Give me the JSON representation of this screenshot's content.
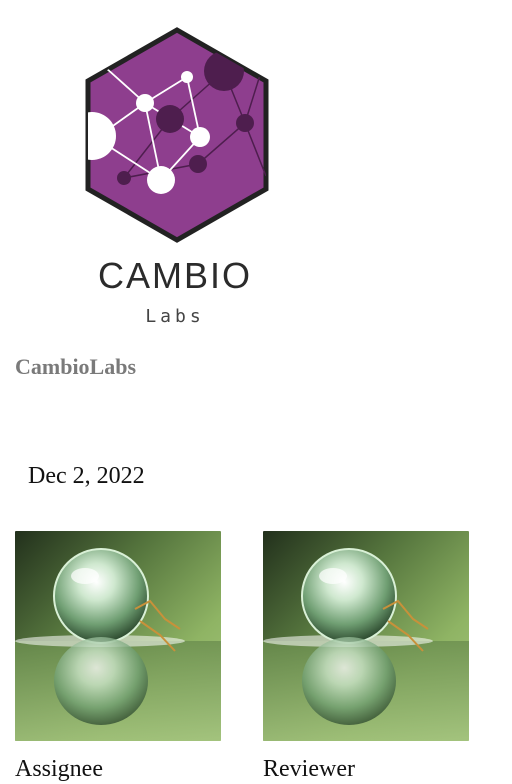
{
  "brand": {
    "logo_word": "CAMBIO",
    "logo_sub": "Labs",
    "name": "CambioLabs",
    "colors": {
      "hexagon": "#8e3e8e",
      "hexagon_border": "#222222",
      "node_dark": "#4e1e4e",
      "node_light": "#ffffff"
    }
  },
  "date": "Dec 2, 2022",
  "people": [
    {
      "role": "Assignee",
      "avatar": "water-droplet-avatar"
    },
    {
      "role": "Reviewer",
      "avatar": "water-droplet-avatar"
    }
  ]
}
